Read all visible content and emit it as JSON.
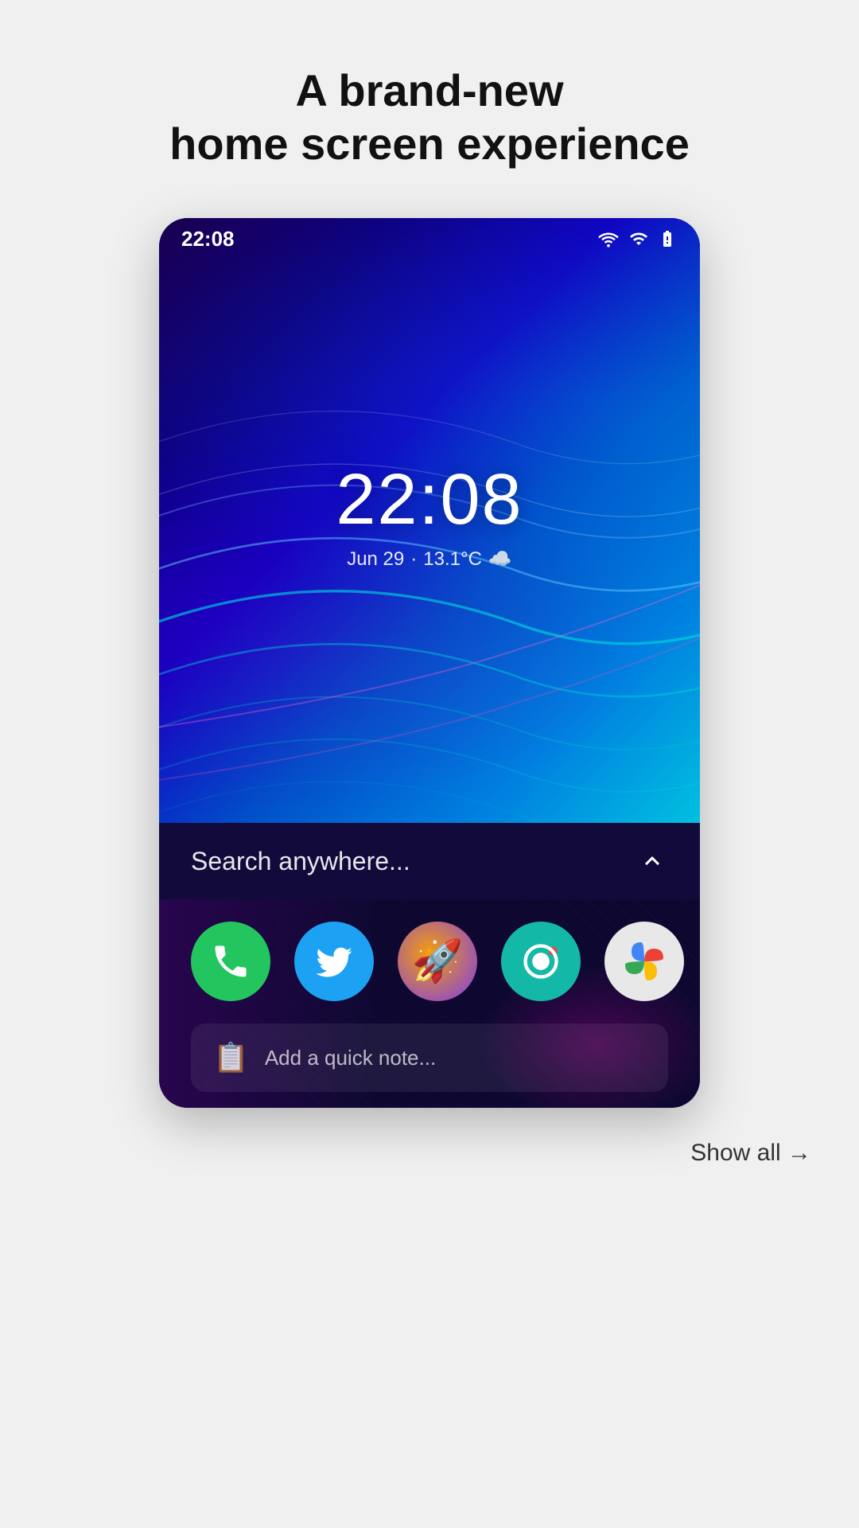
{
  "page": {
    "title_line1": "A brand-new",
    "title_line2": "home screen experience"
  },
  "statusBar": {
    "time": "22:08",
    "wifi_icon": "wifi",
    "signal_icon": "signal",
    "battery_icon": "battery"
  },
  "clockWidget": {
    "time": "22:08",
    "date": "Jun 29",
    "temperature": "13.1°C",
    "weather_icon": "☁️"
  },
  "searchBar": {
    "placeholder": "Search anywhere...",
    "chevron_icon": "chevron-up"
  },
  "apps": [
    {
      "name": "Phone",
      "icon_type": "phone",
      "color": "#22c55e"
    },
    {
      "name": "Twitter",
      "icon_type": "twitter",
      "color": "#1da1f2"
    },
    {
      "name": "Rocket Launcher",
      "icon_type": "rocket",
      "color": "#7c3aed"
    },
    {
      "name": "Camera",
      "icon_type": "camera",
      "color": "#14b8a6"
    },
    {
      "name": "Photos",
      "icon_type": "photos",
      "color": "#e8e8e8"
    }
  ],
  "quickNote": {
    "placeholder": "Add a quick note...",
    "icon": "📋"
  },
  "footer": {
    "show_all_label": "Show all →"
  }
}
